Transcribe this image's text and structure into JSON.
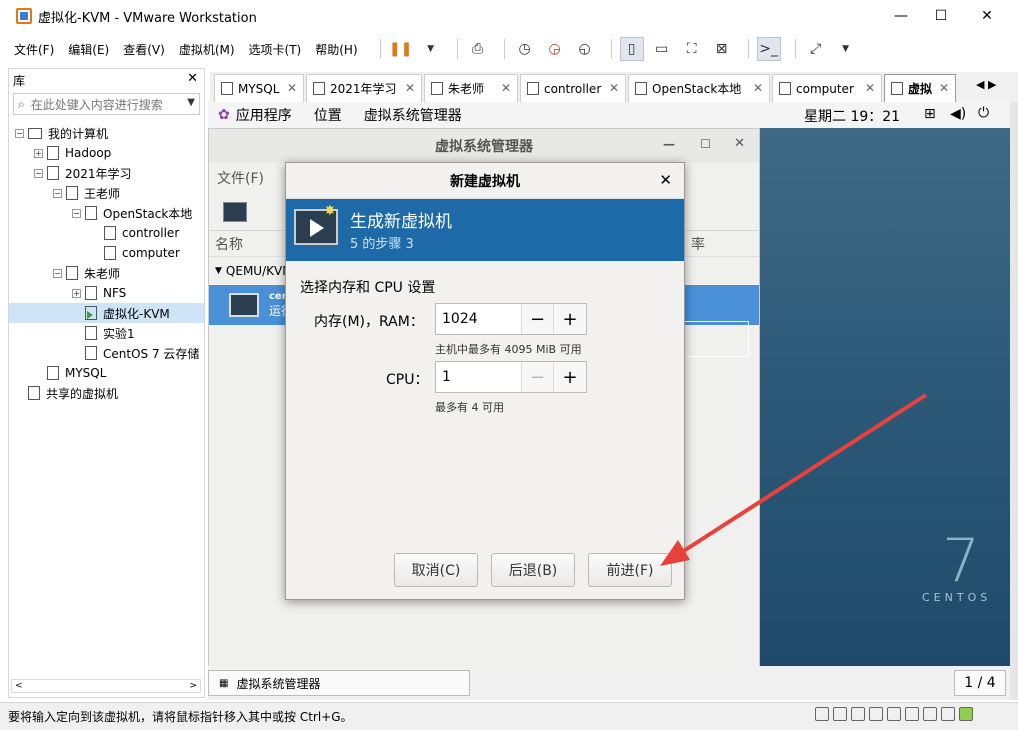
{
  "window": {
    "title": "虚拟化-KVM - VMware Workstation",
    "controls": [
      "—",
      "☐",
      "✕"
    ]
  },
  "menubar": {
    "items": [
      "文件(F)",
      "编辑(E)",
      "查看(V)",
      "虚拟机(M)",
      "选项卡(T)",
      "帮助(H)"
    ]
  },
  "library": {
    "title": "库",
    "close": "✕",
    "search_placeholder": "在此处键入内容进行搜索",
    "tree": [
      {
        "label": "我的计算机",
        "indent": 0,
        "expander": "⊟",
        "icon": "pc"
      },
      {
        "label": "Hadoop",
        "indent": 1,
        "expander": "⊞",
        "icon": "folder"
      },
      {
        "label": "2021年学习",
        "indent": 1,
        "expander": "⊟",
        "icon": "folder"
      },
      {
        "label": "王老师",
        "indent": 2,
        "expander": "⊟",
        "icon": "folder"
      },
      {
        "label": "OpenStack本地",
        "indent": 3,
        "expander": "⊟",
        "icon": "folder"
      },
      {
        "label": "controller",
        "indent": 4,
        "expander": "",
        "icon": "vm"
      },
      {
        "label": "computer",
        "indent": 4,
        "expander": "",
        "icon": "vm"
      },
      {
        "label": "朱老师",
        "indent": 2,
        "expander": "⊟",
        "icon": "folder"
      },
      {
        "label": "NFS",
        "indent": 3,
        "expander": "⊞",
        "icon": "folder"
      },
      {
        "label": "虚拟化-KVM",
        "indent": 3,
        "expander": "",
        "icon": "vm-run",
        "selected": true
      },
      {
        "label": "实验1",
        "indent": 3,
        "expander": "",
        "icon": "vm"
      },
      {
        "label": "CentOS 7 云存储",
        "indent": 3,
        "expander": "",
        "icon": "vm"
      },
      {
        "label": "MYSQL",
        "indent": 1,
        "expander": "",
        "icon": "vm"
      },
      {
        "label": "共享的虚拟机",
        "indent": 0,
        "expander": "",
        "icon": "shared"
      }
    ]
  },
  "tabs": [
    {
      "label": "MYSQL"
    },
    {
      "label": "2021年学习"
    },
    {
      "label": "朱老师"
    },
    {
      "label": "controller"
    },
    {
      "label": "OpenStack本地"
    },
    {
      "label": "computer"
    },
    {
      "label": "虚拟",
      "active": true
    }
  ],
  "gnome": {
    "apps": "应用程序",
    "places": "位置",
    "manager": "虚拟系统管理器",
    "clock": "星期二 19：21"
  },
  "manager": {
    "title": "虚拟系统管理器",
    "menu_file": "文件(F)",
    "col_name": "名称",
    "col_rate": "率",
    "group": "QEMU/KVM",
    "row_name": "cen",
    "row_status": "运行"
  },
  "dialog": {
    "title": "新建虚拟机",
    "banner_title": "生成新虚拟机",
    "banner_step": "5 的步骤 3",
    "section": "选择内存和 CPU 设置",
    "memory_label": "内存(M)，RAM：",
    "memory_value": "1024",
    "memory_hint": "主机中最多有 4095 MiB 可用",
    "cpu_label": "CPU：",
    "cpu_value": "1",
    "cpu_hint": "最多有 4 可用",
    "minus": "−",
    "plus": "+",
    "cancel": "取消(C)",
    "back": "后退(B)",
    "forward": "前进(F)"
  },
  "centos": {
    "version": "7",
    "word": "CENTOS"
  },
  "vm_bottom": {
    "taskbar_label": "虚拟系统管理器",
    "workspace": "1 / 4"
  },
  "statusbar": {
    "text": "要将输入定向到该虚拟机，请将鼠标指针移入其中或按 Ctrl+G。"
  },
  "colors": {
    "banner": "#1e6aa8",
    "selection": "#4a90d9",
    "arrow": "#e8413b"
  }
}
